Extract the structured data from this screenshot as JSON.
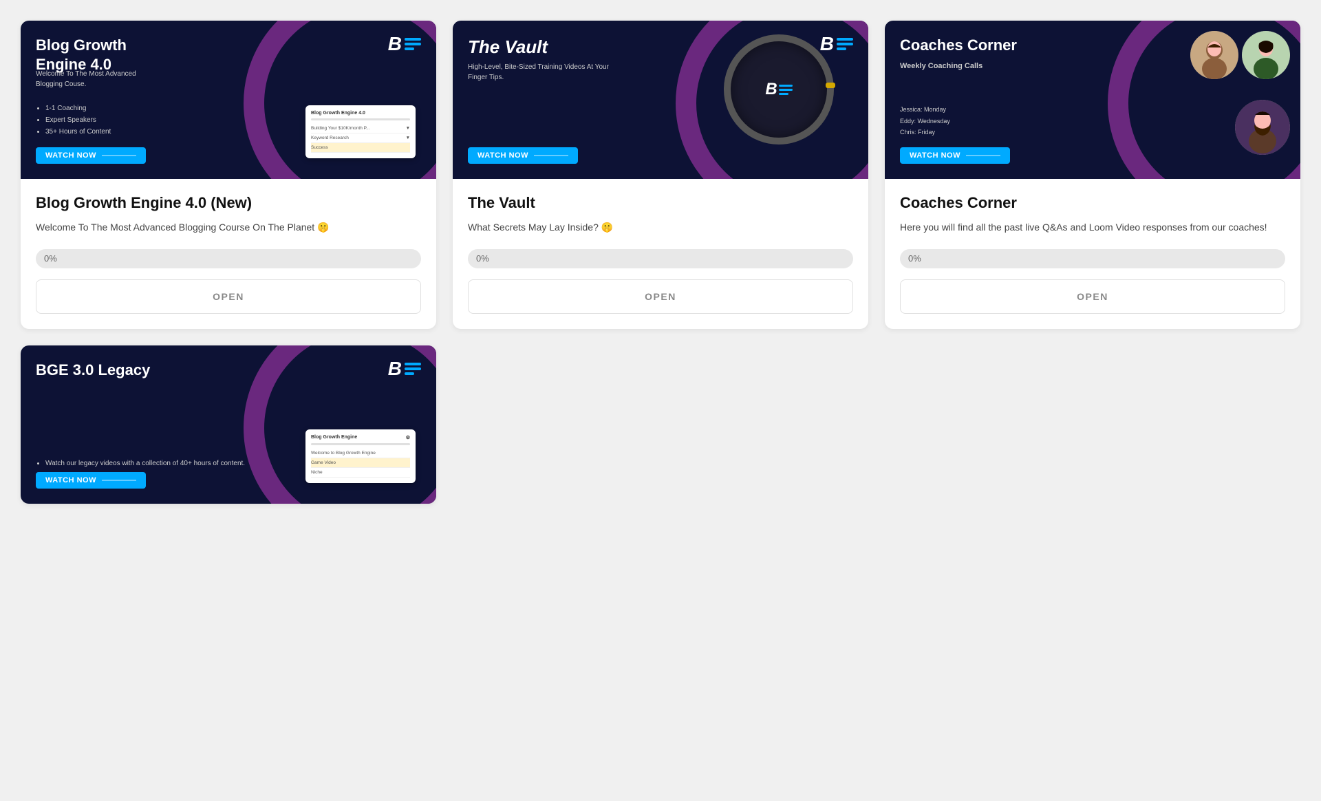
{
  "cards": [
    {
      "id": "bge4",
      "banner_title": "Blog Growth Engine 4.0",
      "logo_text": "BG",
      "subtitle": "Welcome To The Most Advanced Blogging Couse.",
      "bullets": [
        "1-1 Coaching",
        "Expert Speakers",
        "35+ Hours of Content"
      ],
      "watch_label": "WATCH NOW",
      "title": "Blog Growth Engine 4.0 (New)",
      "description": "Welcome To The Most Advanced Blogging Course On The Planet 🤫",
      "progress": "0%",
      "open_label": "OPEN",
      "mockup_title": "Blog Growth Engine 4.0",
      "mockup_rows": [
        "Building Your $10K/month P...",
        "Keyword Research",
        "Success"
      ]
    },
    {
      "id": "vault",
      "banner_title": "The Vault",
      "logo_text": "BG",
      "subtitle": "High-Level, Bite-Sized Training Videos At Your Finger Tips.",
      "watch_label": "WATCH NOW",
      "title": "The Vault",
      "description": "What Secrets May Lay Inside? 🤫",
      "progress": "0%",
      "open_label": "OPEN"
    },
    {
      "id": "coaches",
      "banner_title": "Coaches Corner",
      "logo_text": "BG",
      "weekly_label": "Weekly Coaching Calls",
      "coaches_list": [
        "Jessica: Monday",
        "Eddy: Wednesday",
        "Chris: Friday"
      ],
      "watch_label": "WATCH NOW",
      "title": "Coaches Corner",
      "description": "Here you will find all the past live Q&As and Loom Video responses from our coaches!",
      "progress": "0%",
      "open_label": "OPEN"
    }
  ],
  "bottom_cards": [
    {
      "id": "bge3",
      "banner_title": "BGE 3.0 Legacy",
      "logo_text": "BG",
      "bullets": [
        "Watch our legacy videos with a collection of 40+ hours of content."
      ],
      "watch_label": "WATCH NOW",
      "mockup_title": "Blog Growth Engine",
      "mockup_rows": [
        "Welcome to Blog Growth Engine",
        "Game Video",
        "Niche"
      ]
    }
  ],
  "accent_color": "#00aaff",
  "brand_dark": "#0d1235",
  "purple": "#7b2d8b"
}
